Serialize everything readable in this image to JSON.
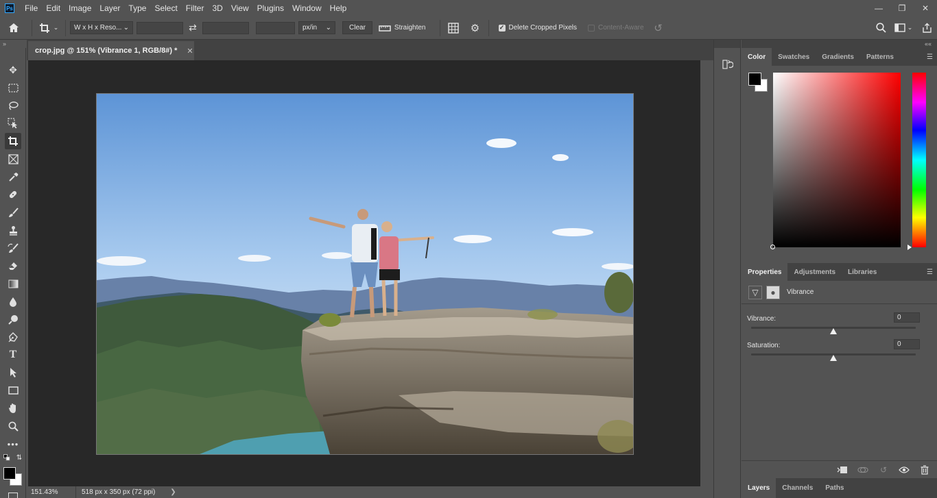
{
  "app": {
    "logo": "Ps",
    "menu": [
      "File",
      "Edit",
      "Image",
      "Layer",
      "Type",
      "Select",
      "Filter",
      "3D",
      "View",
      "Plugins",
      "Window",
      "Help"
    ],
    "window_controls": {
      "minimize": "—",
      "restore": "❐",
      "close": "✕"
    }
  },
  "options_bar": {
    "home_icon": "home-icon",
    "crop_tool_icon": "crop-icon",
    "ratio_select": "W x H x Reso...",
    "width_value": "",
    "height_value": "",
    "resolution_value": "",
    "unit_select": "px/in",
    "clear_label": "Clear",
    "straighten_label": "Straighten",
    "delete_cropped_pixels": {
      "label": "Delete Cropped Pixels",
      "checked": true
    },
    "content_aware": {
      "label": "Content-Aware",
      "checked": false
    }
  },
  "toolbar": {
    "collapse": "»",
    "tools": [
      "move",
      "marquee",
      "lasso",
      "object-selection",
      "crop",
      "frame",
      "eyedropper",
      "healing-brush",
      "brush",
      "clone-stamp",
      "history-brush",
      "eraser",
      "gradient",
      "blur",
      "dodge",
      "pen",
      "type",
      "path-selection",
      "rectangle",
      "hand",
      "zoom",
      "more"
    ],
    "active_tool": "crop"
  },
  "document": {
    "tab_title": "crop.jpg @ 151% (Vibrance 1, RGB/8#) *",
    "close": "✕"
  },
  "status": {
    "zoom": "151.43%",
    "info": "518 px x 350 px (72 ppi)",
    "arrow": "❯"
  },
  "color_panel": {
    "tabs": [
      "Color",
      "Swatches",
      "Gradients",
      "Patterns"
    ],
    "active_tab": "Color",
    "foreground": "#000000",
    "background": "#ffffff",
    "hue": "#ff0000"
  },
  "properties_panel": {
    "tabs": [
      "Properties",
      "Adjustments",
      "Libraries"
    ],
    "active_tab": "Properties",
    "title": "Vibrance",
    "vibrance": {
      "label": "Vibrance:",
      "value": "0",
      "level": 0
    },
    "saturation": {
      "label": "Saturation:",
      "value": "0",
      "level": 0
    }
  },
  "layers_panel": {
    "tabs": [
      "Layers",
      "Channels",
      "Paths"
    ],
    "active_tab": "Layers"
  }
}
